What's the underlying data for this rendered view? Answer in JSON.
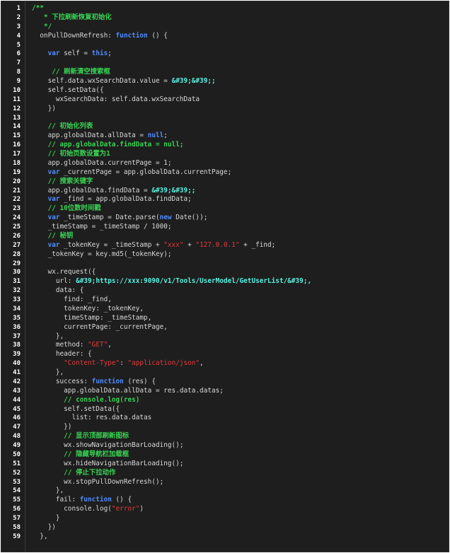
{
  "editor": {
    "lines": [
      {
        "n": "1",
        "tokens": [
          [
            "cm",
            "/**"
          ]
        ]
      },
      {
        "n": "2",
        "tokens": [
          [
            "p",
            "   "
          ],
          [
            "cm",
            "* 下拉刷新恢复初始化"
          ]
        ]
      },
      {
        "n": "3",
        "tokens": [
          [
            "p",
            "   "
          ],
          [
            "cm",
            "*/"
          ]
        ]
      },
      {
        "n": "4",
        "tokens": [
          [
            "p",
            "  onPullDownRefresh: "
          ],
          [
            "kw",
            "function"
          ],
          [
            "p",
            " () {"
          ]
        ]
      },
      {
        "n": "5",
        "tokens": []
      },
      {
        "n": "6",
        "tokens": [
          [
            "p",
            "    "
          ],
          [
            "kw",
            "var"
          ],
          [
            "p",
            " self = "
          ],
          [
            "kw",
            "this"
          ],
          [
            "p",
            ";"
          ]
        ]
      },
      {
        "n": "7",
        "tokens": []
      },
      {
        "n": "8",
        "tokens": [
          [
            "p",
            "     "
          ],
          [
            "cm",
            "// 刷新清空搜索框"
          ]
        ]
      },
      {
        "n": "9",
        "tokens": [
          [
            "p",
            "    self.data.wxSearchData.value = "
          ],
          [
            "ent",
            "&#39;&#39;;"
          ]
        ]
      },
      {
        "n": "10",
        "tokens": [
          [
            "p",
            "    self.setData({"
          ]
        ]
      },
      {
        "n": "11",
        "tokens": [
          [
            "p",
            "      wxSearchData: self.data.wxSearchData"
          ]
        ]
      },
      {
        "n": "12",
        "tokens": [
          [
            "p",
            "    })"
          ]
        ]
      },
      {
        "n": "13",
        "tokens": []
      },
      {
        "n": "14",
        "tokens": [
          [
            "p",
            "    "
          ],
          [
            "cm",
            "// 初始化列表"
          ]
        ]
      },
      {
        "n": "15",
        "tokens": [
          [
            "p",
            "    app.globalData.allData = "
          ],
          [
            "kw",
            "null"
          ],
          [
            "p",
            ";"
          ]
        ]
      },
      {
        "n": "16",
        "tokens": [
          [
            "p",
            "    "
          ],
          [
            "cm",
            "// app.globalData.findData = null;"
          ]
        ]
      },
      {
        "n": "17",
        "tokens": [
          [
            "p",
            "    "
          ],
          [
            "cm",
            "// 初始页数设置为1"
          ]
        ]
      },
      {
        "n": "18",
        "tokens": [
          [
            "p",
            "    app.globalData.currentPage = 1;"
          ]
        ]
      },
      {
        "n": "19",
        "tokens": [
          [
            "p",
            "    "
          ],
          [
            "kw",
            "var"
          ],
          [
            "p",
            " _currentPage = app.globalData.currentPage;"
          ]
        ]
      },
      {
        "n": "20",
        "tokens": [
          [
            "p",
            "    "
          ],
          [
            "cm",
            "// 搜索关键字"
          ]
        ]
      },
      {
        "n": "21",
        "tokens": [
          [
            "p",
            "    app.globalData.findData = "
          ],
          [
            "ent",
            "&#39;&#39;;"
          ]
        ]
      },
      {
        "n": "22",
        "tokens": [
          [
            "p",
            "    "
          ],
          [
            "kw",
            "var"
          ],
          [
            "p",
            " _find = app.globalData.findData;"
          ]
        ]
      },
      {
        "n": "23",
        "tokens": [
          [
            "p",
            "    "
          ],
          [
            "cm",
            "// 10位数时间戳"
          ]
        ]
      },
      {
        "n": "24",
        "tokens": [
          [
            "p",
            "    "
          ],
          [
            "kw",
            "var"
          ],
          [
            "p",
            " _timeStamp = Date.parse("
          ],
          [
            "kw",
            "new"
          ],
          [
            "p",
            " Date());"
          ]
        ]
      },
      {
        "n": "25",
        "tokens": [
          [
            "p",
            "    _timeStamp = _timeStamp / 1000;"
          ]
        ]
      },
      {
        "n": "26",
        "tokens": [
          [
            "p",
            "    "
          ],
          [
            "cm",
            "// 秘钥"
          ]
        ]
      },
      {
        "n": "27",
        "tokens": [
          [
            "p",
            "    "
          ],
          [
            "kw",
            "var"
          ],
          [
            "p",
            " _tokenKey = _timeStamp + "
          ],
          [
            "str",
            "\"xxx\""
          ],
          [
            "p",
            " + "
          ],
          [
            "str",
            "\"127.0.0.1\""
          ],
          [
            "p",
            " + _find;"
          ]
        ]
      },
      {
        "n": "28",
        "tokens": [
          [
            "p",
            "    _tokenKey = key.md5(_tokenKey);"
          ]
        ]
      },
      {
        "n": "29",
        "tokens": []
      },
      {
        "n": "30",
        "tokens": [
          [
            "p",
            "    wx.request({"
          ]
        ]
      },
      {
        "n": "31",
        "tokens": [
          [
            "p",
            "      url: "
          ],
          [
            "ent",
            "&#39;https://xxx:9090/v1/Tools/UserModel/GetUserList/&#39;,"
          ]
        ]
      },
      {
        "n": "32",
        "tokens": [
          [
            "p",
            "      data: {"
          ]
        ]
      },
      {
        "n": "33",
        "tokens": [
          [
            "p",
            "        find: _find,"
          ]
        ]
      },
      {
        "n": "34",
        "tokens": [
          [
            "p",
            "        tokenKey: _tokenKey,"
          ]
        ]
      },
      {
        "n": "35",
        "tokens": [
          [
            "p",
            "        timeStamp: _timeStamp,"
          ]
        ]
      },
      {
        "n": "36",
        "tokens": [
          [
            "p",
            "        currentPage: _currentPage,"
          ]
        ]
      },
      {
        "n": "37",
        "tokens": [
          [
            "p",
            "      },"
          ]
        ]
      },
      {
        "n": "38",
        "tokens": [
          [
            "p",
            "      method: "
          ],
          [
            "str",
            "\"GET\""
          ],
          [
            "p",
            ","
          ]
        ]
      },
      {
        "n": "39",
        "tokens": [
          [
            "p",
            "      header: {"
          ]
        ]
      },
      {
        "n": "40",
        "tokens": [
          [
            "p",
            "        "
          ],
          [
            "str",
            "\"Content-Type\""
          ],
          [
            "p",
            ": "
          ],
          [
            "str",
            "\"application/json\""
          ],
          [
            "p",
            ","
          ]
        ]
      },
      {
        "n": "41",
        "tokens": [
          [
            "p",
            "      },"
          ]
        ]
      },
      {
        "n": "42",
        "tokens": [
          [
            "p",
            "      success: "
          ],
          [
            "kw",
            "function"
          ],
          [
            "p",
            " (res) {"
          ]
        ]
      },
      {
        "n": "43",
        "tokens": [
          [
            "p",
            "        app.globalData.allData = res.data.datas;"
          ]
        ]
      },
      {
        "n": "44",
        "tokens": [
          [
            "p",
            "        "
          ],
          [
            "cm",
            "// console.log(res)"
          ]
        ]
      },
      {
        "n": "45",
        "tokens": [
          [
            "p",
            "        self.setData({"
          ]
        ]
      },
      {
        "n": "46",
        "tokens": [
          [
            "p",
            "          list: res.data.datas"
          ]
        ]
      },
      {
        "n": "47",
        "tokens": [
          [
            "p",
            "        })"
          ]
        ]
      },
      {
        "n": "48",
        "tokens": [
          [
            "p",
            "        "
          ],
          [
            "cm",
            "// 显示顶部刷新图标"
          ]
        ]
      },
      {
        "n": "49",
        "tokens": [
          [
            "p",
            "        wx.showNavigationBarLoading();"
          ]
        ]
      },
      {
        "n": "50",
        "tokens": [
          [
            "p",
            "        "
          ],
          [
            "cm",
            "// 隐藏导航栏加载框"
          ]
        ]
      },
      {
        "n": "51",
        "tokens": [
          [
            "p",
            "        wx.hideNavigationBarLoading();"
          ]
        ]
      },
      {
        "n": "52",
        "tokens": [
          [
            "p",
            "        "
          ],
          [
            "cm",
            "// 停止下拉动作"
          ]
        ]
      },
      {
        "n": "53",
        "tokens": [
          [
            "p",
            "        wx.stopPullDownRefresh();"
          ]
        ]
      },
      {
        "n": "54",
        "tokens": [
          [
            "p",
            "      },"
          ]
        ]
      },
      {
        "n": "55",
        "tokens": [
          [
            "p",
            "      fail: "
          ],
          [
            "kw",
            "function"
          ],
          [
            "p",
            " () {"
          ]
        ]
      },
      {
        "n": "56",
        "tokens": [
          [
            "p",
            "        console.log("
          ],
          [
            "str",
            "\"error\""
          ],
          [
            "p",
            ")"
          ]
        ]
      },
      {
        "n": "57",
        "tokens": [
          [
            "p",
            "      }"
          ]
        ]
      },
      {
        "n": "58",
        "tokens": [
          [
            "p",
            "    })"
          ]
        ]
      },
      {
        "n": "59",
        "tokens": [
          [
            "p",
            "  },"
          ]
        ]
      }
    ]
  }
}
